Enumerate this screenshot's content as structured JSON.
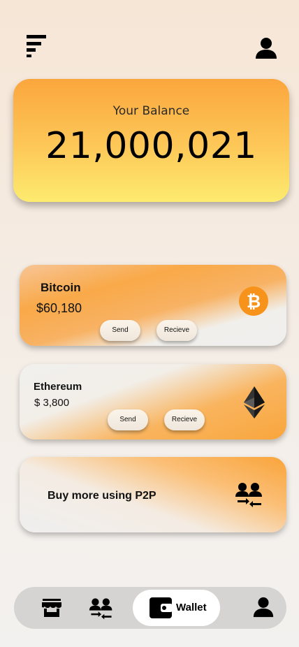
{
  "balance": {
    "label": "Your Balance",
    "value": "21,000,021"
  },
  "coins": [
    {
      "name": "Bitcoin",
      "price": "$60,180",
      "send_label": "Send",
      "receive_label": "Recieve",
      "icon": "bitcoin-icon"
    },
    {
      "name": "Ethereum",
      "price": "$ 3,800",
      "send_label": "Send",
      "receive_label": "Recieve",
      "icon": "ethereum-icon"
    }
  ],
  "p2p": {
    "label": "Buy more using P2P",
    "icon": "p2p-exchange-icon"
  },
  "bottom_nav": {
    "items": [
      "store-icon",
      "p2p-exchange-icon",
      "wallet-icon",
      "profile-icon"
    ],
    "active_label": "Wallet"
  },
  "colors": {
    "accent_orange": "#f9a63c",
    "balance_yellow": "#fdeb6f",
    "bitcoin_orange": "#f7931a",
    "nav_bg": "#d6d4d2"
  }
}
